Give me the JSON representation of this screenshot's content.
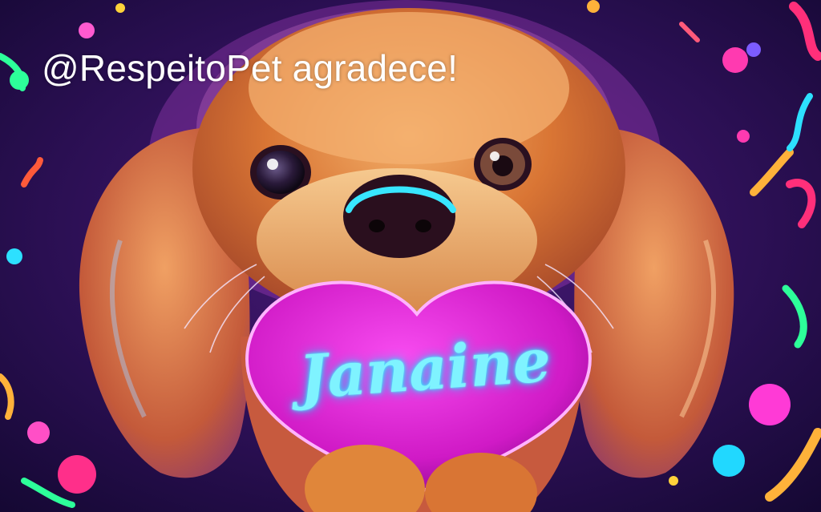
{
  "caption": "@RespeitoPet agradece!",
  "heart_name": "Janaine",
  "colors": {
    "background": "#1a0b3a",
    "fur": "#e0863a",
    "heart": "#e21ad9",
    "neon_text": "#7ff3ff",
    "caption_text": "#ffffff"
  }
}
